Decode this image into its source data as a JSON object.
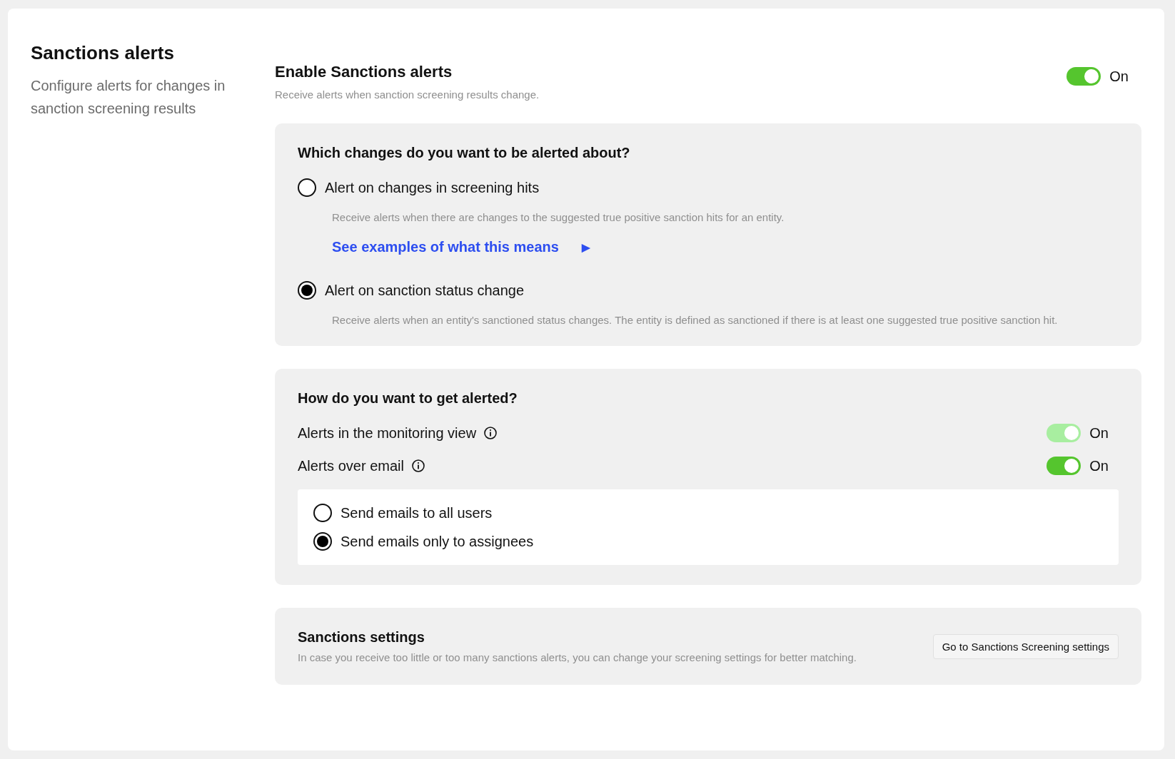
{
  "intro": {
    "title": "Sanctions alerts",
    "description": "Configure alerts for changes in sanction screening results"
  },
  "enable": {
    "title": "Enable Sanctions alerts",
    "description": "Receive alerts when sanction screening results change.",
    "toggle": {
      "on": true,
      "disabled": false,
      "label": "On"
    }
  },
  "changes": {
    "title": "Which changes do you want to be alerted about?",
    "options": [
      {
        "label": "Alert on changes in screening hits",
        "selected": false,
        "description": "Receive alerts when there are changes to the suggested true positive sanction hits for an entity.",
        "link": "See examples of what this means",
        "link_icon": "▶"
      },
      {
        "label": "Alert on sanction status change",
        "selected": true,
        "description": "Receive alerts when an entity's sanctioned status changes. The entity is defined as sanctioned if there is at least one suggested true positive sanction hit."
      }
    ]
  },
  "delivery": {
    "title": "How do you want to get alerted?",
    "channels": [
      {
        "label": "Alerts in the monitoring view",
        "toggle": {
          "on": true,
          "disabled": true,
          "label": "On"
        }
      },
      {
        "label": "Alerts over email",
        "toggle": {
          "on": true,
          "disabled": false,
          "label": "On"
        }
      }
    ],
    "recipients": [
      {
        "label": "Send emails to all users",
        "selected": false
      },
      {
        "label": "Send emails only to assignees",
        "selected": true
      }
    ]
  },
  "settings": {
    "title": "Sanctions settings",
    "description": "In case you receive too little or too many sanctions alerts, you can change your screening settings for better matching.",
    "button": "Go to Sanctions Screening settings"
  }
}
